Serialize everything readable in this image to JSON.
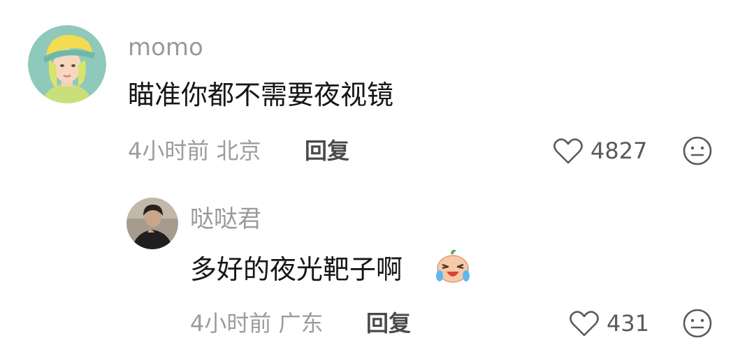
{
  "comments": [
    {
      "username": "momo",
      "text": "瞄准你都不需要夜视镜",
      "time_location": "4小时前 北京",
      "reply_label": "回复",
      "likes": "4827",
      "avatar": "illustrated-girl-yellow-cap-avatar"
    },
    {
      "username": "哒哒君",
      "text": "多好的夜光靶子啊",
      "emoji": "crying-laughing-emoji",
      "time_location": "4小时前 广东",
      "reply_label": "回复",
      "likes": "431",
      "avatar": "man-photo-avatar"
    }
  ],
  "icons": {
    "like": "heart-outline-icon",
    "dislike": "meh-face-icon"
  },
  "colors": {
    "username": "#9a9a9a",
    "text": "#161616",
    "meta": "#9c9c9c",
    "background": "#ffffff"
  }
}
